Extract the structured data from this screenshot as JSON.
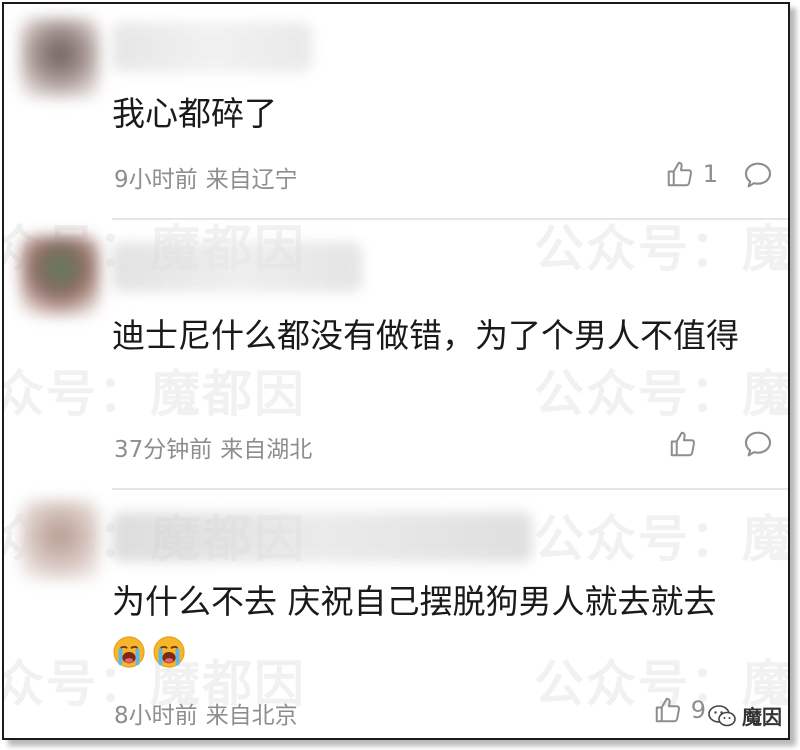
{
  "watermark": {
    "left_text": "众号：魔都因",
    "right_text": "公众号：魔"
  },
  "comments": [
    {
      "text": "我心都碎了",
      "time": "9小时前",
      "location": "来自辽宁",
      "likes": "1"
    },
    {
      "text": "迪士尼什么都没有做错，为了个男人不值得",
      "time": "37分钟前",
      "location": "来自湖北",
      "likes": ""
    },
    {
      "text": "为什么不去 庆祝自己摆脱狗男人就去就去",
      "emoji_icons": [
        "crying-face-icon",
        "crying-face-icon"
      ],
      "time": "8小时前",
      "location": "来自北京",
      "likes": "9"
    }
  ],
  "badge": {
    "icon": "wechat-icon",
    "label": "魔因"
  }
}
